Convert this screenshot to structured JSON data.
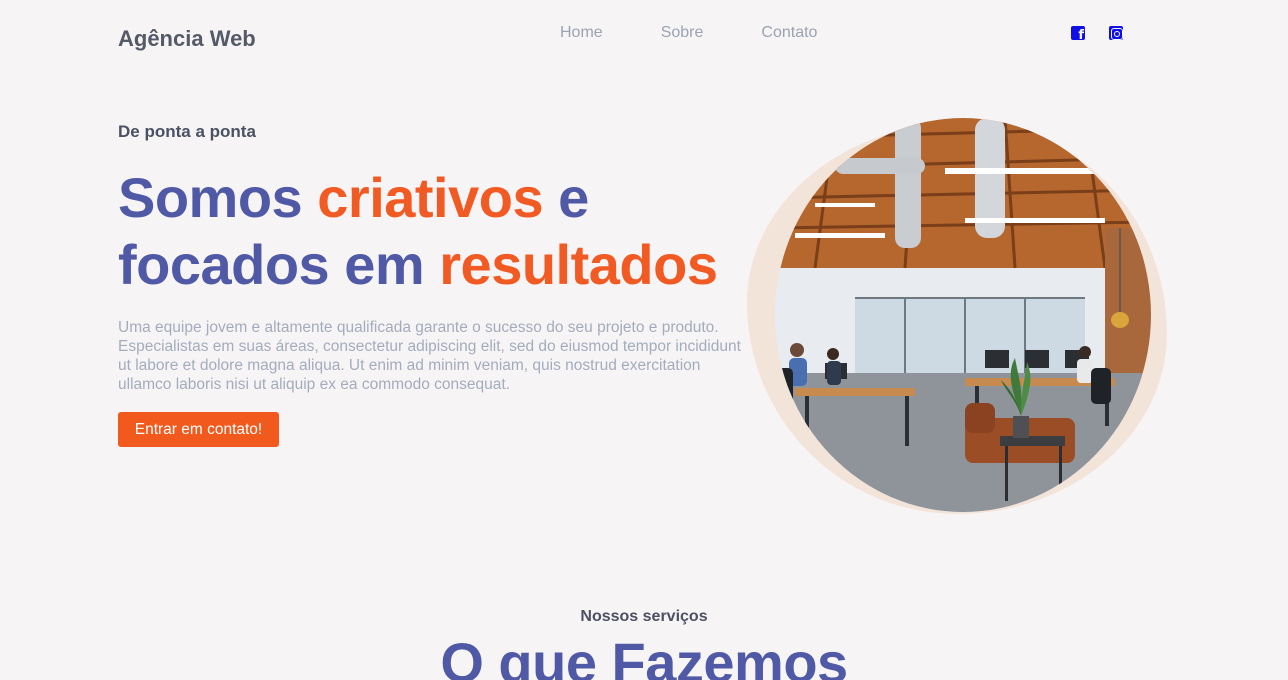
{
  "header": {
    "brand": "Agência Web",
    "nav": [
      "Home",
      "Sobre",
      "Contato"
    ],
    "social": [
      "facebook-icon",
      "instagram-icon"
    ],
    "social_color": "#1010e6"
  },
  "hero": {
    "eyebrow": "De ponta a ponta",
    "headline": {
      "part1": "Somos ",
      "accent1": "criativos",
      "part2": " e focados em ",
      "accent2": "resultados"
    },
    "description": "Uma equipe jovem e altamente qualificada garante o sucesso do seu projeto e produto. Especialistas em suas áreas, consectetur adipiscing elit, sed do eiusmod tempor incididunt ut labore et dolore magna aliqua. Ut enim ad minim veniam, quis nostrud exercitation ullamco laboris nisi ut aliquip ex ea commodo consequat.",
    "cta": "Entrar em contato!"
  },
  "services": {
    "eyebrow": "Nossos serviços",
    "title": "O que Fazemos"
  },
  "colors": {
    "primary": "#5059a6",
    "accent": "#f15a22",
    "background": "#f7f4f6",
    "blob": "#f3e4da"
  }
}
